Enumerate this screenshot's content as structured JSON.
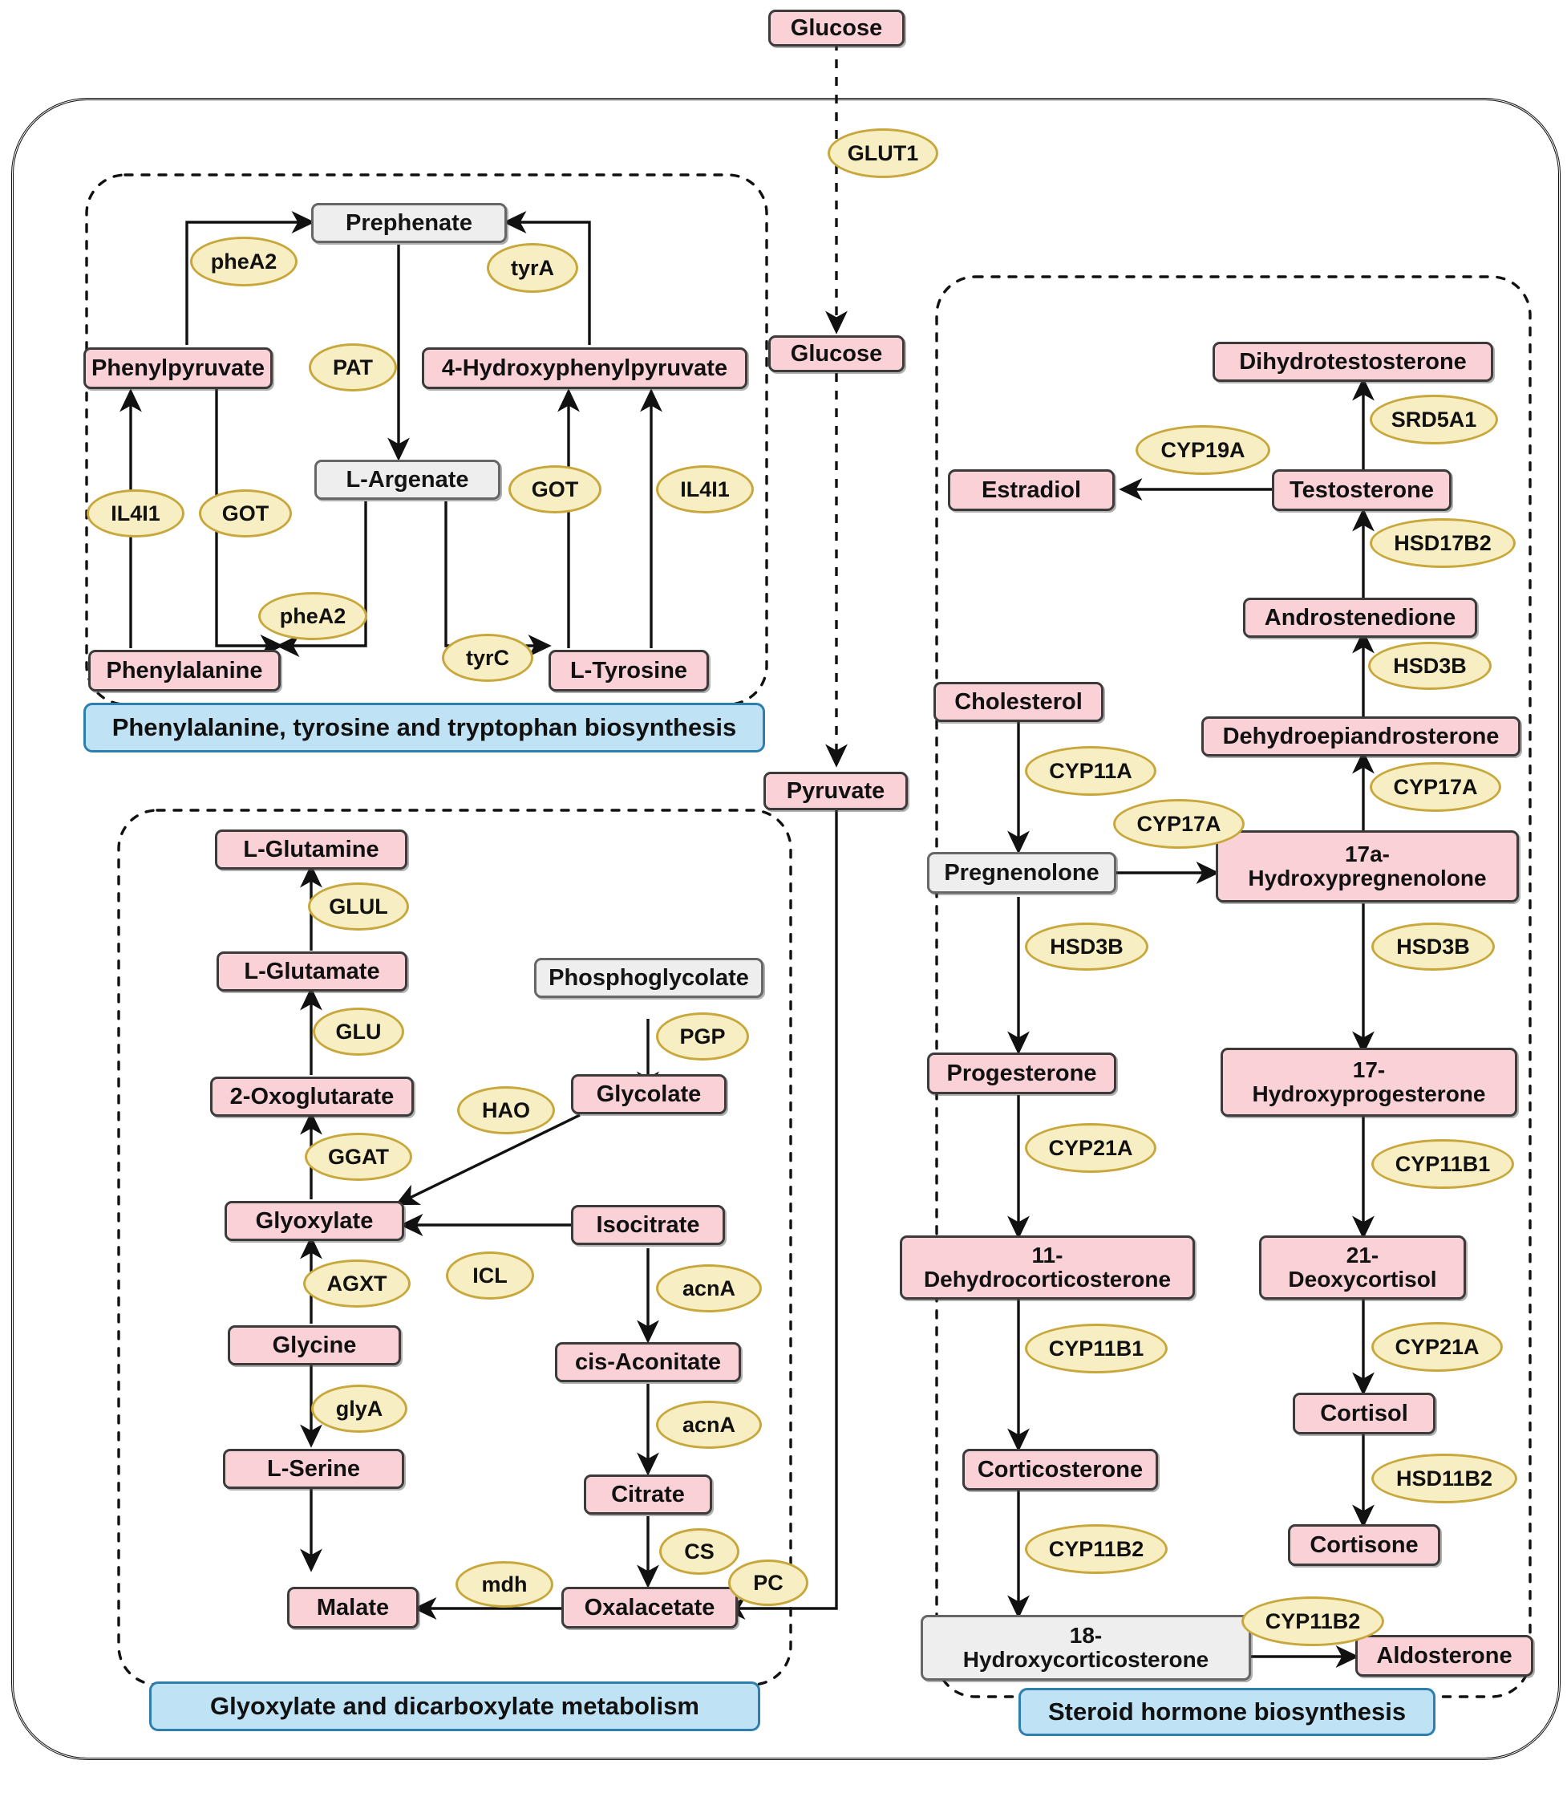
{
  "diagram": {
    "title": "Metabolic pathway map",
    "colors": {
      "metabolite_fill": "#fad1d6",
      "intermediate_fill": "#eeeeee",
      "enzyme_fill": "#f8eec3",
      "enzyme_border": "#c8a83c",
      "pathway_label_fill": "#bfe2f4",
      "pathway_label_border": "#2e7fae",
      "stroke": "#111111"
    }
  },
  "pathway_labels": [
    {
      "id": "phe",
      "text": "Phenylalanine, tyrosine and tryptophan biosynthesis"
    },
    {
      "id": "glx",
      "text": "Glyoxylate and dicarboxylate metabolism"
    },
    {
      "id": "ste",
      "text": "Steroid hormone biosynthesis"
    }
  ],
  "metabolites": {
    "glucose_out": "Glucose",
    "glucose_in": "Glucose",
    "pyruvate": "Pyruvate",
    "prephenate": "Prephenate",
    "phenylpyruvate": "Phenylpyruvate",
    "hydroxyphenylpyruvate": "4-Hydroxyphenylpyruvate",
    "l_argenate": "L-Argenate",
    "phenylalanine": "Phenylalanine",
    "l_tyrosine": "L-Tyrosine",
    "l_glutamine": "L-Glutamine",
    "l_glutamate": "L-Glutamate",
    "oxoglutarate": "2-Oxoglutarate",
    "glyoxylate": "Glyoxylate",
    "glycine": "Glycine",
    "l_serine": "L-Serine",
    "phosphoglycolate": "Phosphoglycolate",
    "glycolate": "Glycolate",
    "isocitrate": "Isocitrate",
    "cis_aconitate": "cis-Aconitate",
    "citrate": "Citrate",
    "oxalacetate": "Oxalacetate",
    "malate": "Malate",
    "dihydrotestosterone": "Dihydrotestosterone",
    "testosterone": "Testosterone",
    "estradiol": "Estradiol",
    "androstenedione": "Androstenedione",
    "dehydroepiandrosterone": "Dehydroepiandrosterone",
    "cholesterol": "Cholesterol",
    "pregnenolone": "Pregnenolone",
    "hydroxypregnenolone": "17a-\nHydroxypregnenolone",
    "progesterone": "Progesterone",
    "hydroxyprogesterone": "17-\nHydroxyprogesterone",
    "dehydrocorticosterone": "11-\nDehydrocorticosterone",
    "deoxycortisol": "21-\nDeoxycortisol",
    "corticosterone": "Corticosterone",
    "cortisol": "Cortisol",
    "cortisone": "Cortisone",
    "hydroxycorticosterone": "18-\nHydroxycorticosterone",
    "aldosterone": "Aldosterone"
  },
  "enzymes": {
    "glut1": "GLUT1",
    "phea2_top": "pheA2",
    "tyra": "tyrA",
    "pat": "PAT",
    "got_left": "GOT",
    "got_mid": "GOT",
    "il4i1_left": "IL4I1",
    "il4i1_right": "IL4I1",
    "phea2_bottom": "pheA2",
    "tyrc": "tyrC",
    "glul": "GLUL",
    "glu": "GLU",
    "ggat": "GGAT",
    "agxt": "AGXT",
    "glya": "glyA",
    "pgp": "PGP",
    "hao": "HAO",
    "icl": "ICL",
    "acna_top": "acnA",
    "acna_bottom": "acnA",
    "cs": "CS",
    "mdh": "mdh",
    "pc": "PC",
    "srd5a1": "SRD5A1",
    "cyp19a": "CYP19A",
    "hsd17b2": "HSD17B2",
    "hsd3b_right_top": "HSD3B",
    "cyp17a_up": "CYP17A",
    "cyp11a": "CYP11A",
    "cyp17a_side": "CYP17A",
    "hsd3b_left": "HSD3B",
    "hsd3b_right": "HSD3B",
    "cyp21a_left": "CYP21A",
    "cyp11b1_right": "CYP11B1",
    "cyp11b1_left": "CYP11B1",
    "cyp21a_right": "CYP21A",
    "hsd11b2": "HSD11B2",
    "cyp11b2_left": "CYP11B2",
    "cyp11b2_right": "CYP11B2"
  },
  "chart_data": {
    "type": "diagram",
    "nodes": 40,
    "enzyme_labels": 39,
    "compartments": [
      "Phenylalanine, tyrosine and tryptophan biosynthesis",
      "Glyoxylate and dicarboxylate metabolism",
      "Steroid hormone biosynthesis"
    ]
  }
}
